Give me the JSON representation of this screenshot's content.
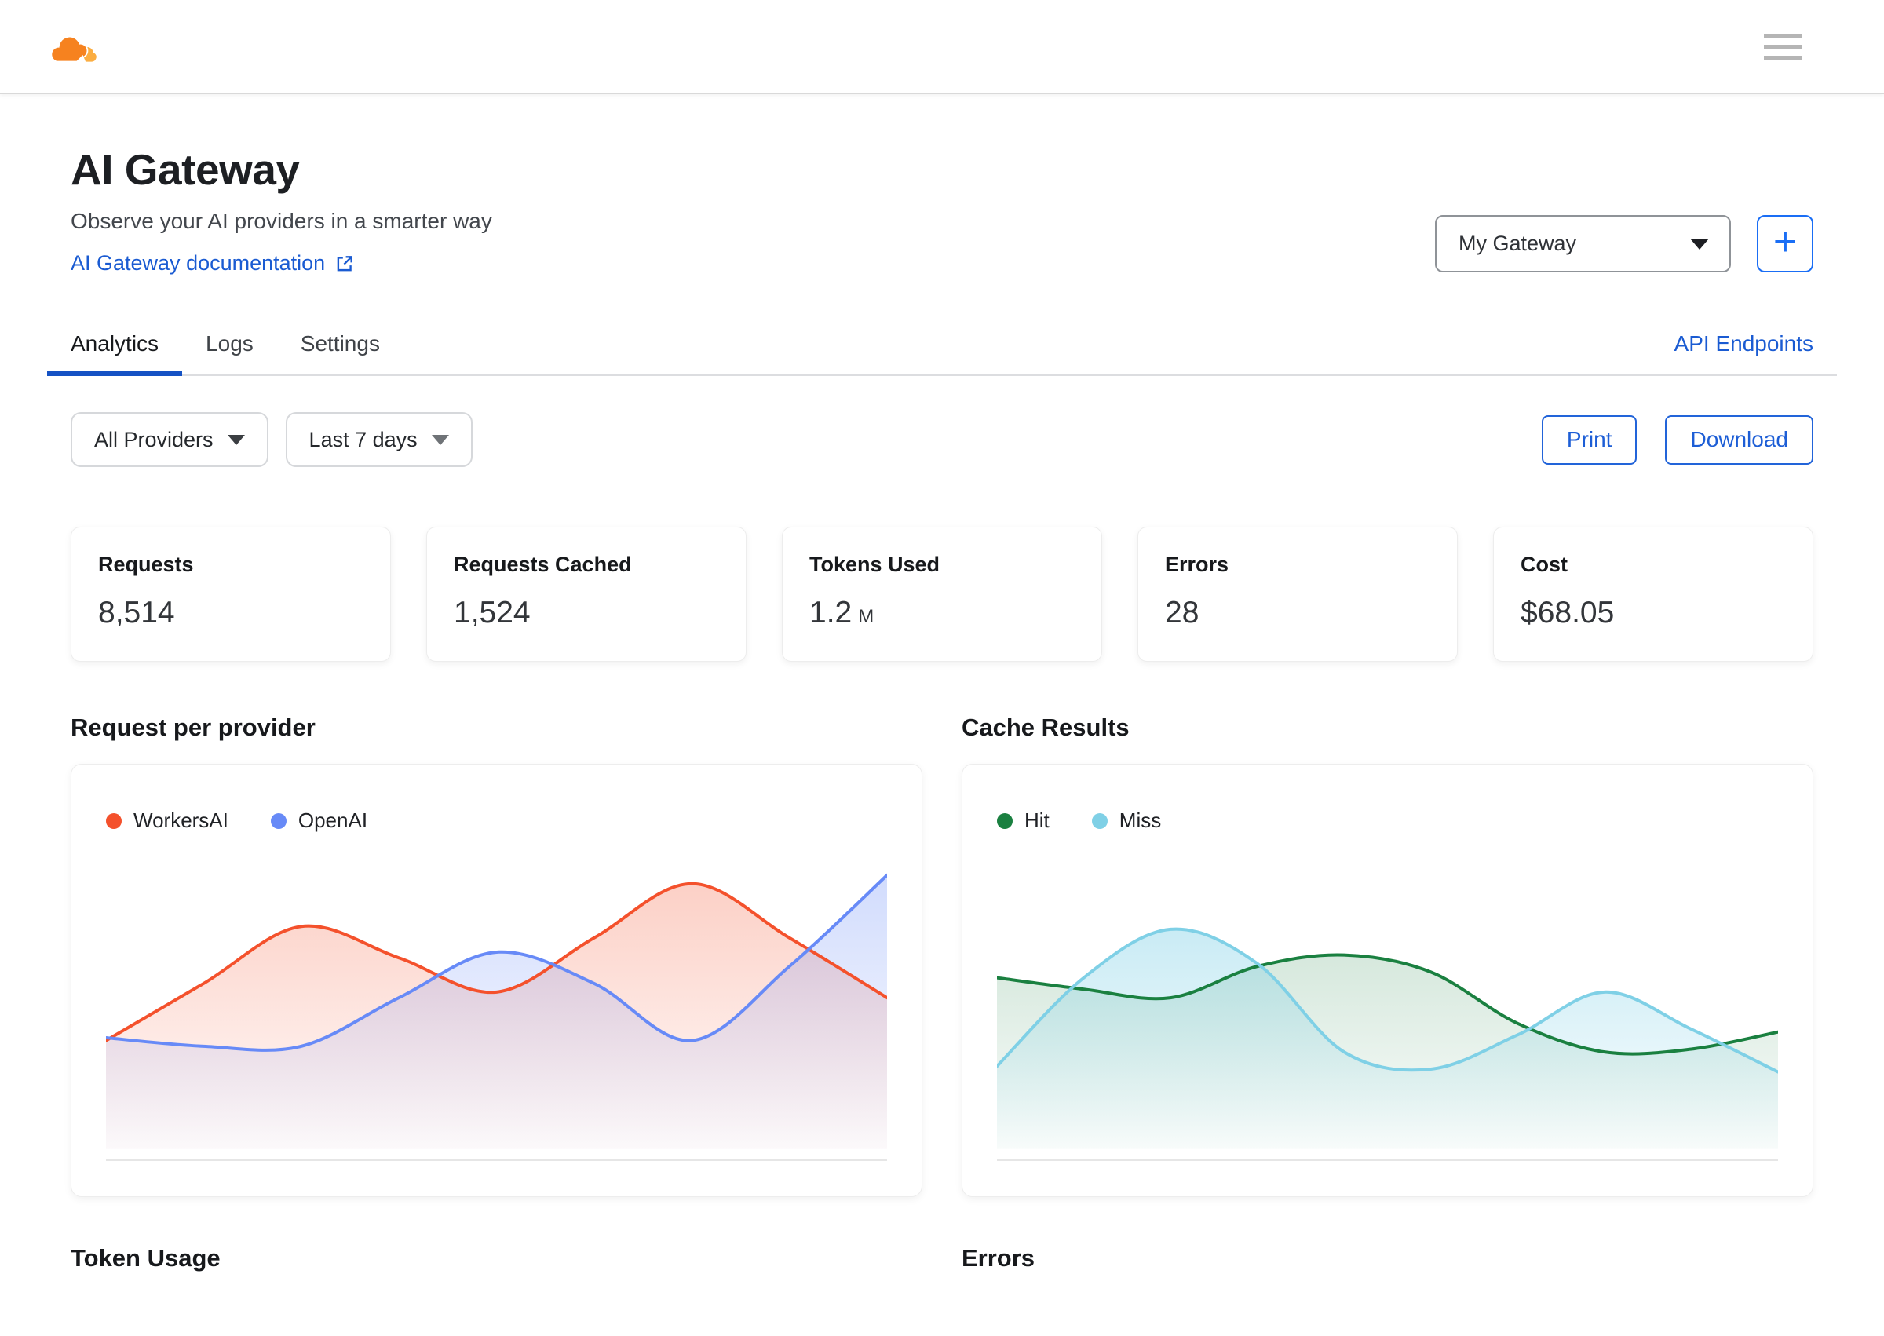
{
  "header": {
    "logo_alt": "Cloudflare",
    "brand_colors": {
      "cloud_main": "#F6821F",
      "cloud_light": "#FBAD41"
    }
  },
  "page": {
    "title": "AI Gateway",
    "subtitle": "Observe your AI providers in a smarter way",
    "doc_link_label": "AI Gateway documentation"
  },
  "gateway": {
    "selected": "My Gateway",
    "add_button_glyph": "+"
  },
  "tabs": [
    {
      "label": "Analytics",
      "active": true
    },
    {
      "label": "Logs",
      "active": false
    },
    {
      "label": "Settings",
      "active": false
    }
  ],
  "api_endpoints_label": "API Endpoints",
  "filters": {
    "provider": "All Providers",
    "date_range": "Last 7 days"
  },
  "actions": {
    "print": "Print",
    "download": "Download"
  },
  "stats": [
    {
      "label": "Requests",
      "value": "8,514"
    },
    {
      "label": "Requests Cached",
      "value": "1,524"
    },
    {
      "label": "Tokens Used",
      "value": "1.2",
      "suffix": "M"
    },
    {
      "label": "Errors",
      "value": "28"
    },
    {
      "label": "Cost",
      "value": "$68.05"
    }
  ],
  "sections": {
    "requests_chart": "Request per provider",
    "cache_chart": "Cache Results",
    "token_usage": "Token Usage",
    "errors": "Errors"
  },
  "colors": {
    "accent_blue": "#1a5bd2",
    "tab_underline": "#1552c4",
    "workersai": "#f4512c",
    "openai": "#678af7",
    "hit": "#1a8040",
    "miss": "#7fd0e6"
  },
  "chart_data": [
    {
      "type": "area",
      "title": "Request per provider",
      "x_axis": "time over last 7 days (ticks not labeled)",
      "y_axis": "requests (axis not labeled)",
      "unit": "estimated % of plot height",
      "grid": false,
      "legend_position": "top-left",
      "series": [
        {
          "name": "WorkersAI",
          "color": "#f4512c",
          "fill_opacity": 0.27,
          "values": [
            38,
            58,
            78,
            67,
            55,
            74,
            93,
            74,
            53
          ]
        },
        {
          "name": "OpenAI",
          "color": "#678af7",
          "fill_opacity": 0.3,
          "values": [
            39,
            36,
            36,
            53,
            69,
            58,
            38,
            64,
            96
          ]
        }
      ]
    },
    {
      "type": "area",
      "title": "Cache Results",
      "x_axis": "time over last 7 days (ticks not labeled)",
      "y_axis": "cache results (axis not labeled)",
      "unit": "estimated % of plot height",
      "grid": false,
      "legend_position": "top-left",
      "series": [
        {
          "name": "Hit",
          "color": "#1a8040",
          "fill_opacity": 0.18,
          "values": [
            60,
            56,
            53,
            64,
            68,
            62,
            44,
            34,
            35,
            41
          ]
        },
        {
          "name": "Miss",
          "color": "#7fd0e6",
          "fill_opacity": 0.42,
          "values": [
            29,
            60,
            77,
            65,
            34,
            28,
            40,
            55,
            42,
            27
          ]
        }
      ]
    }
  ]
}
